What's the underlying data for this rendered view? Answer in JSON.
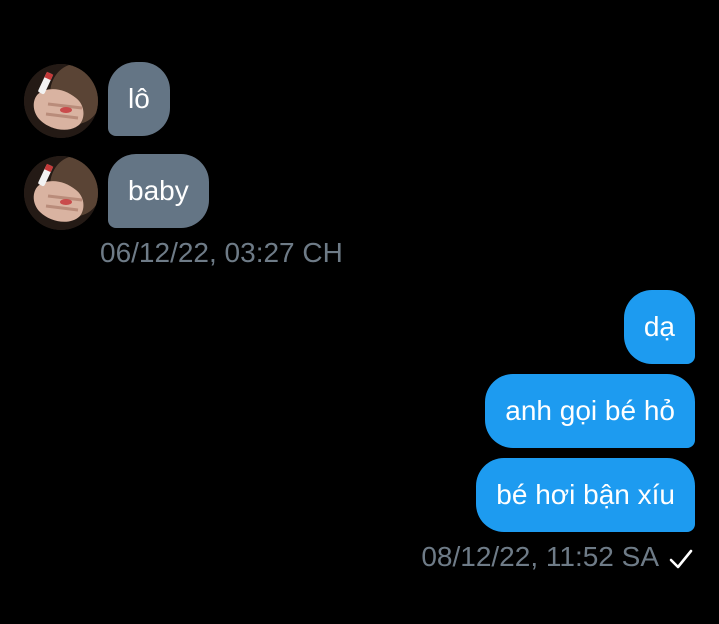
{
  "conversation": {
    "received": [
      {
        "text": "lô",
        "avatar_icon": "profile-photo-hand-cigarette"
      },
      {
        "text": "baby",
        "avatar_icon": "profile-photo-hand-cigarette"
      }
    ],
    "received_timestamp": "06/12/22, 03:27 CH",
    "sent": [
      {
        "text": "dạ"
      },
      {
        "text": "anh gọi bé hỏ"
      },
      {
        "text": "bé hơi bận xíu"
      }
    ],
    "sent_timestamp": "08/12/22, 11:52 SA",
    "sent_status_icon": "checkmark-icon"
  },
  "colors": {
    "background": "#000000",
    "received_bubble": "#647585",
    "sent_bubble": "#1d9bf0",
    "timestamp_text": "#6e7b87",
    "bubble_text": "#ffffff"
  }
}
